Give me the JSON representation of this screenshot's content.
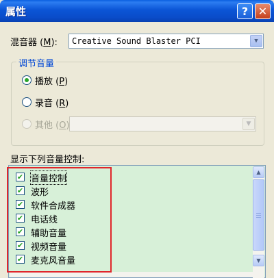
{
  "window": {
    "title": "属性",
    "help_glyph": "?",
    "close_glyph": "✕"
  },
  "mixer": {
    "label_text": "混音器 (",
    "label_key": "M",
    "label_end": "):",
    "value": "Creative Sound Blaster PCI",
    "dropdown_glyph": "▼"
  },
  "adjust_group": {
    "title": "调节音量",
    "options": [
      {
        "text": "播放 (",
        "key": "P",
        "end": ")",
        "checked": true,
        "enabled": true
      },
      {
        "text": "录音 (",
        "key": "R",
        "end": ")",
        "checked": false,
        "enabled": true
      },
      {
        "text": "其他 (",
        "key": "O",
        "end": ")",
        "checked": false,
        "enabled": false
      }
    ],
    "other_dropdown_glyph": "▼"
  },
  "controls": {
    "header": "显示下列音量控制:",
    "check_glyph": "✔",
    "items": [
      {
        "label": "音量控制",
        "checked": true
      },
      {
        "label": "波形",
        "checked": true
      },
      {
        "label": "软件合成器",
        "checked": true
      },
      {
        "label": "电话线",
        "checked": true
      },
      {
        "label": "辅助音量",
        "checked": true
      },
      {
        "label": "视频音量",
        "checked": true
      },
      {
        "label": "麦克风音量",
        "checked": true
      }
    ],
    "scroll_up_glyph": "▲",
    "scroll_down_glyph": "▼"
  },
  "colors": {
    "titlebar": "#0a4cc9",
    "group_title": "#0046d5",
    "list_bg": "#d7f0d8",
    "highlight_box": "#e0252b",
    "check": "#21a121"
  }
}
